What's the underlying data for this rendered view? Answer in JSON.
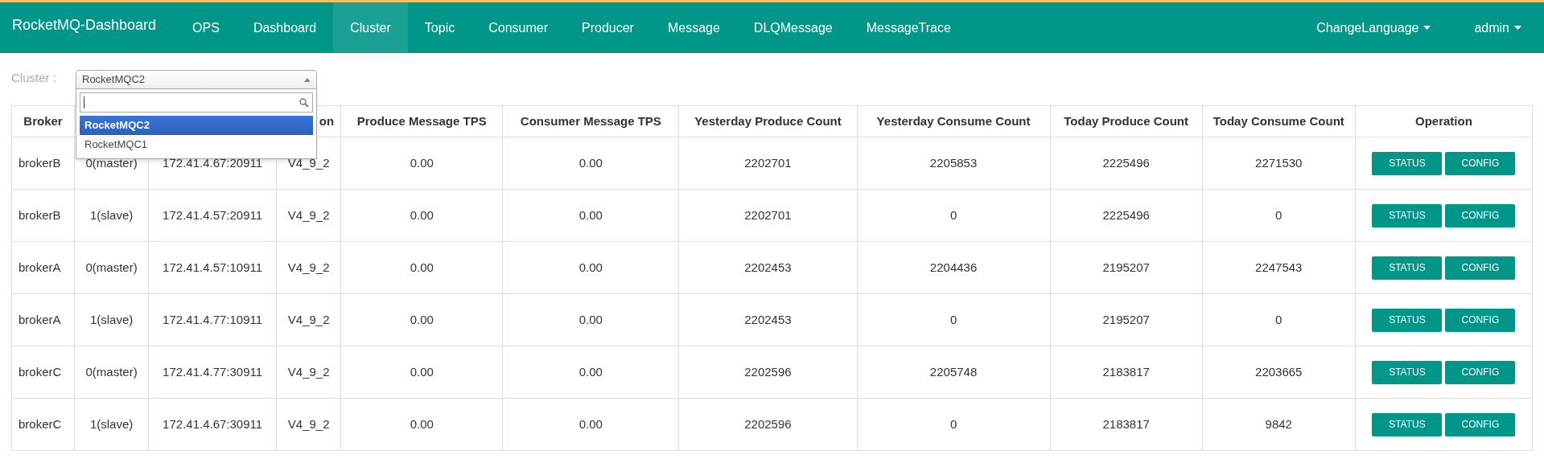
{
  "navbar": {
    "brand": "RocketMQ-Dashboard",
    "items": [
      {
        "label": "OPS",
        "selected": false
      },
      {
        "label": "Dashboard",
        "selected": false
      },
      {
        "label": "Cluster",
        "selected": true
      },
      {
        "label": "Topic",
        "selected": false
      },
      {
        "label": "Consumer",
        "selected": false
      },
      {
        "label": "Producer",
        "selected": false
      },
      {
        "label": "Message",
        "selected": false
      },
      {
        "label": "DLQMessage",
        "selected": false
      },
      {
        "label": "MessageTrace",
        "selected": false
      }
    ],
    "right_menus": [
      "ChangeLanguage",
      "admin"
    ]
  },
  "cluster_filter": {
    "label": "Cluster :",
    "value": "RocketMQC2",
    "expanded": true,
    "options": [
      {
        "label": "RocketMQC2",
        "selected": true
      },
      {
        "label": "RocketMQC1",
        "selected": false
      }
    ]
  },
  "table": {
    "columns": [
      {
        "label": "Broker"
      },
      {},
      {},
      {
        "label": "on"
      },
      {
        "label": "Produce Message TPS"
      },
      {
        "label": "Consumer Message TPS"
      },
      {
        "label": "Yesterday Produce Count"
      },
      {
        "label": "Yesterday Consume Count"
      },
      {
        "label": "Today Produce Count"
      },
      {
        "label": "Today Consume Count"
      },
      {
        "label": "Operation"
      }
    ],
    "rows": [
      {
        "cells": [
          "brokerB",
          "0(master)",
          "172.41.4.67:20911",
          "V4_9_2",
          "0.00",
          "0.00",
          "2202701",
          "2205853",
          "2225496",
          "2271530"
        ],
        "buttons": [
          "STATUS",
          "CONFIG"
        ]
      },
      {
        "cells": [
          "brokerB",
          "1(slave)",
          "172.41.4.57:20911",
          "V4_9_2",
          "0.00",
          "0.00",
          "2202701",
          "0",
          "2225496",
          "0"
        ],
        "buttons": [
          "STATUS",
          "CONFIG"
        ]
      },
      {
        "cells": [
          "brokerA",
          "0(master)",
          "172.41.4.57:10911",
          "V4_9_2",
          "0.00",
          "0.00",
          "2202453",
          "2204436",
          "2195207",
          "2247543"
        ],
        "buttons": [
          "STATUS",
          "CONFIG"
        ]
      },
      {
        "cells": [
          "brokerA",
          "1(slave)",
          "172.41.4.77:10911",
          "V4_9_2",
          "0.00",
          "0.00",
          "2202453",
          "0",
          "2195207",
          "0"
        ],
        "buttons": [
          "STATUS",
          "CONFIG"
        ]
      },
      {
        "cells": [
          "brokerC",
          "0(master)",
          "172.41.4.77:30911",
          "V4_9_2",
          "0.00",
          "0.00",
          "2202596",
          "2205748",
          "2183817",
          "2203665"
        ],
        "buttons": [
          "STATUS",
          "CONFIG"
        ]
      },
      {
        "cells": [
          "brokerC",
          "1(slave)",
          "172.41.4.67:30911",
          "V4_9_2",
          "0.00",
          "0.00",
          "2202596",
          "0",
          "2183817",
          "9842"
        ],
        "buttons": [
          "STATUS",
          "CONFIG"
        ]
      }
    ]
  }
}
